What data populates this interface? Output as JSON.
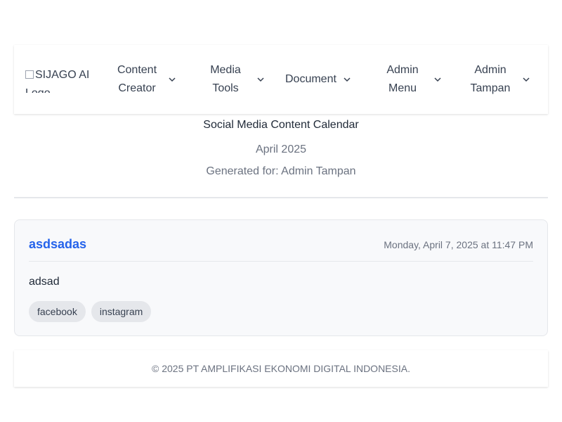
{
  "navbar": {
    "logo_alt": "SIJAGO AI Logo",
    "items": [
      {
        "label": "Content Creator",
        "icon": "chevron-down-icon"
      },
      {
        "label": "Media Tools",
        "icon": "chevron-down-icon"
      },
      {
        "label": "Document",
        "icon": "chevron-down-icon"
      },
      {
        "label": "Admin Menu",
        "icon": "chevron-down-icon"
      },
      {
        "label": "Admin Tampan",
        "icon": "chevron-down-icon"
      }
    ]
  },
  "header": {
    "title": "Social Media Content Calendar",
    "month": "April 2025",
    "generated_for": "Generated for: Admin Tampan"
  },
  "posts": [
    {
      "title": "asdsadas",
      "datetime": "Monday, April 7, 2025 at 11:47 PM",
      "body": "adsad",
      "tags": [
        "facebook",
        "instagram"
      ]
    }
  ],
  "footer": {
    "text": "© 2025 PT AMPLIFIKASI EKONOMI DIGITAL INDONESIA."
  },
  "colors": {
    "accent": "#2563eb",
    "muted_text": "#6b7280",
    "tag_bg": "#e5e7eb",
    "card_bg": "#f8f9fb"
  }
}
